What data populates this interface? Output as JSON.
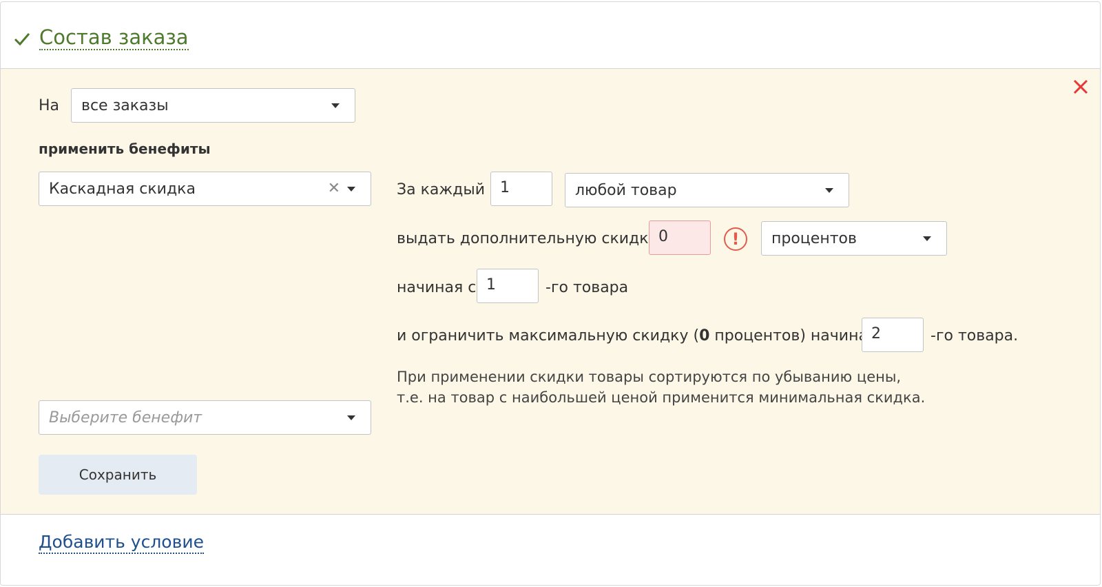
{
  "header": {
    "title": "Состав заказа"
  },
  "condition": {
    "on_label": "На",
    "on_select_value": "все заказы",
    "apply_benefits_label": "применить бенефиты",
    "benefit_select_value": "Каскадная скидка",
    "benefit_placeholder": "Выберите бенефит",
    "save_label": "Сохранить"
  },
  "cascade": {
    "per_each_label": "За каждый",
    "per_each_value": "1",
    "product_select_value": "любой товар",
    "extra_discount_label": "выдать дополнительную скидку",
    "extra_discount_value": "0",
    "warning_glyph": "!",
    "unit_select_value": "процентов",
    "starting_label": "начиная с",
    "starting_value": "1",
    "starting_suffix": "-го товара",
    "limit_prefix": "и ограничить максимальную скидку (",
    "limit_value": "0",
    "limit_middle": " процентов) начиная с",
    "limit_from_value": "2",
    "limit_suffix": "-го товара.",
    "note_line1": "При применении скидки товары сортируются по убыванию цены,",
    "note_line2": "т.е. на товар с наибольшей ценой применится минимальная скидка."
  },
  "footer": {
    "add_condition_label": "Добавить условие"
  },
  "colors": {
    "accent_green": "#4e7a2e",
    "panel_bg": "#fdf7e8",
    "error_red": "#e25b4b",
    "link_blue": "#1f4f8f",
    "button_bg": "#e4ebf2"
  },
  "icons": {
    "check": "check-icon",
    "close": "close-icon",
    "clear": "clear-icon",
    "dropdown": "chevron-down-icon",
    "warning": "warning-icon"
  }
}
